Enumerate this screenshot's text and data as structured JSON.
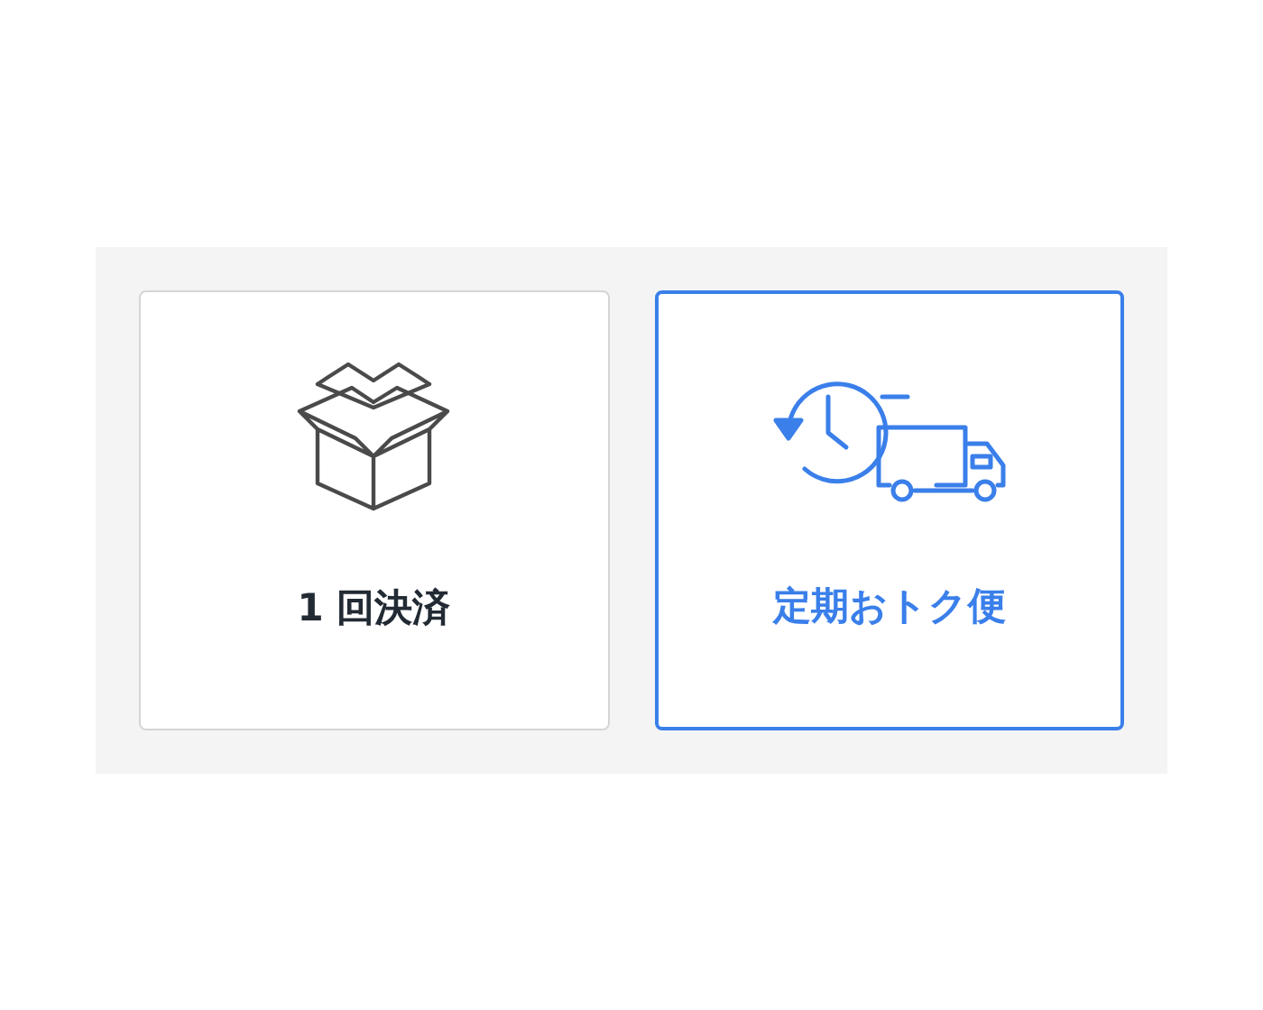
{
  "options": [
    {
      "kind": "box",
      "label": "1 回決済",
      "selected": false
    },
    {
      "kind": "truck",
      "label": "定期おトク便",
      "selected": true
    }
  ]
}
